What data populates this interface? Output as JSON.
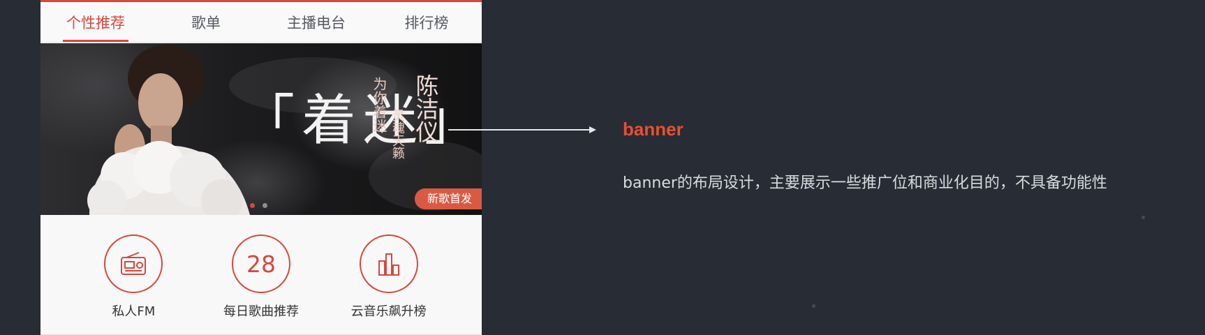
{
  "tabs": [
    {
      "label": "个性推荐",
      "active": true
    },
    {
      "label": "歌单",
      "active": false
    },
    {
      "label": "主播电台",
      "active": false
    },
    {
      "label": "排行榜",
      "active": false
    }
  ],
  "banner": {
    "title": "「着迷」",
    "tagline": "为你着迷",
    "artist": "陈洁仪",
    "subtitle": "灵魂天籁",
    "badge": "新歌首发",
    "dot_count": 2,
    "active_dot": 0
  },
  "entries": [
    {
      "label": "私人FM",
      "icon": "radio-icon"
    },
    {
      "label": "每日歌曲推荐",
      "icon": "calendar-number-icon",
      "number": "28"
    },
    {
      "label": "云音乐飙升榜",
      "icon": "bar-chart-icon"
    }
  ],
  "annotation": {
    "title": "banner",
    "description": "banner的布局设计，主要展示一些推广位和商业化目的，不具备功能性"
  },
  "colors": {
    "accent": "#d6483c",
    "annotation_title": "#e8502f",
    "background": "#282c35"
  }
}
